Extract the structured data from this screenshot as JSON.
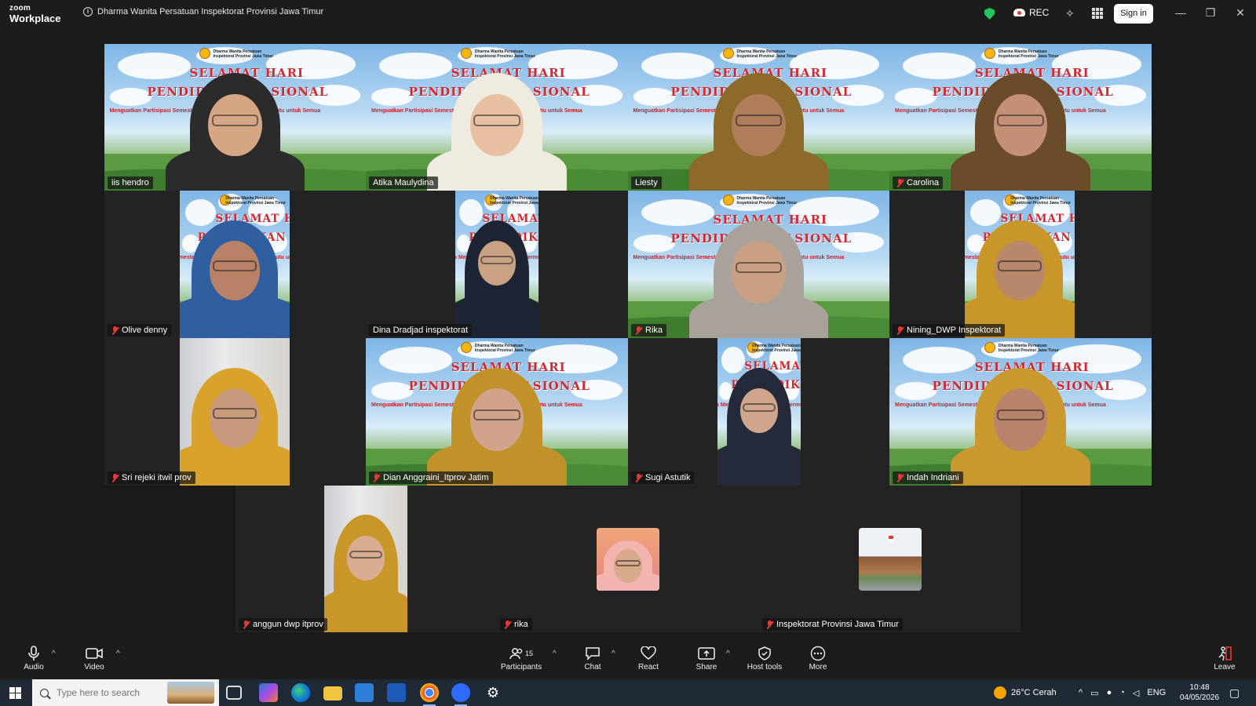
{
  "app": {
    "logo_line1": "zoom",
    "logo_line2": "Workplace",
    "meeting_title": "Dharma Wanita Persatuan Inspektorat Provinsi Jawa Timur",
    "rec_label": "REC",
    "signin_label": "Sign in"
  },
  "banner": {
    "org_line1": "Dharma Wanita Persatuan",
    "org_line2": "Inspektorat Provinsi Jawa Timur",
    "title1": "SELAMAT HARI",
    "title2": "PENDIDIKAN NASIONAL",
    "subtitle": "Menguatkan Partisipasi Semesta Mewujudkan Pendidikan Bermutu untuk Semua"
  },
  "participants": [
    {
      "name": "iis hendro",
      "muted": false,
      "active": false
    },
    {
      "name": "Atika Maulydina",
      "muted": false,
      "active": true
    },
    {
      "name": "Liesty",
      "muted": false,
      "active": false
    },
    {
      "name": "Carolina",
      "muted": true,
      "active": false
    },
    {
      "name": "Olive denny",
      "muted": true,
      "active": false
    },
    {
      "name": "Dina Dradjad inspektorat",
      "muted": false,
      "active": false
    },
    {
      "name": "Rika",
      "muted": true,
      "active": false
    },
    {
      "name": "Nining_DWP Inspektorat",
      "muted": true,
      "active": false
    },
    {
      "name": "Sri rejeki itwil prov",
      "muted": true,
      "active": false
    },
    {
      "name": "Dian Anggraini_Itprov Jatim",
      "muted": true,
      "active": false
    },
    {
      "name": "Sugi Astutik",
      "muted": true,
      "active": false
    },
    {
      "name": "Indah Indriani",
      "muted": true,
      "active": false
    },
    {
      "name": "anggun dwp itprov",
      "muted": true,
      "active": false
    },
    {
      "name": "rika",
      "muted": true,
      "active": false
    },
    {
      "name": "Inspektorat Provinsi Jawa Timur",
      "muted": true,
      "active": false
    }
  ],
  "controls": {
    "audio": "Audio",
    "video": "Video",
    "participants": "Participants",
    "participant_count": "15",
    "chat": "Chat",
    "react": "React",
    "share": "Share",
    "host_tools": "Host tools",
    "more": "More",
    "leave": "Leave"
  },
  "taskbar": {
    "search_placeholder": "Type here to search",
    "weather": "26°C  Cerah",
    "language": "ENG",
    "time": "10:48",
    "date": "04/05/2026"
  },
  "colors": {
    "active_speaker": "#2ecc71",
    "muted": "#e53935",
    "shield": "#22c55e",
    "background": "#1a1a1a"
  }
}
